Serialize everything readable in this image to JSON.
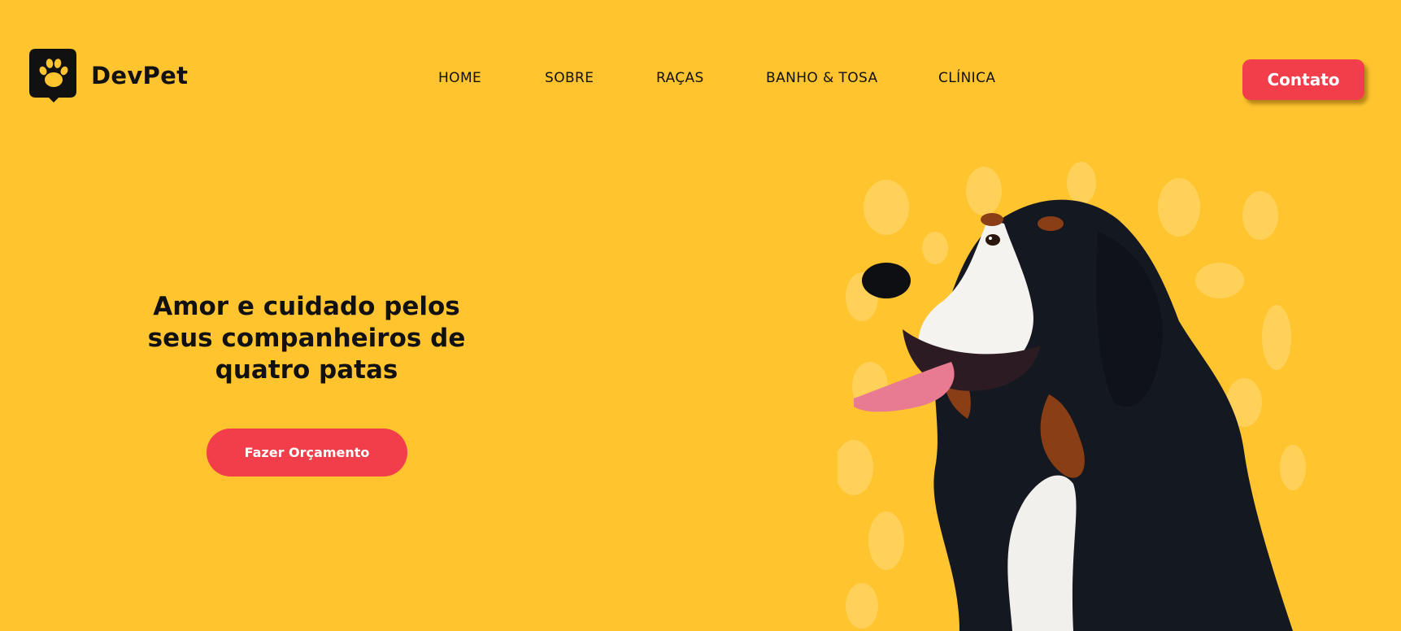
{
  "brand": {
    "name": "DevPet",
    "logo_icon": "paw-chat-bubble-icon"
  },
  "nav": {
    "items": [
      {
        "label": "HOME"
      },
      {
        "label": "SOBRE"
      },
      {
        "label": "RAÇAS"
      },
      {
        "label": "BANHO & TOSA"
      },
      {
        "label": "CLÍNICA"
      }
    ]
  },
  "header": {
    "contact_label": "Contato"
  },
  "hero": {
    "headline_line1": "Amor e cuidado pelos",
    "headline_line2": "seus companheiros de",
    "headline_line3": "quatro patas",
    "cta_label": "Fazer Orçamento",
    "image": "bernese-mountain-dog-photo"
  },
  "colors": {
    "background": "#FFC42E",
    "accent": "#F23E4B",
    "text": "#111111"
  }
}
